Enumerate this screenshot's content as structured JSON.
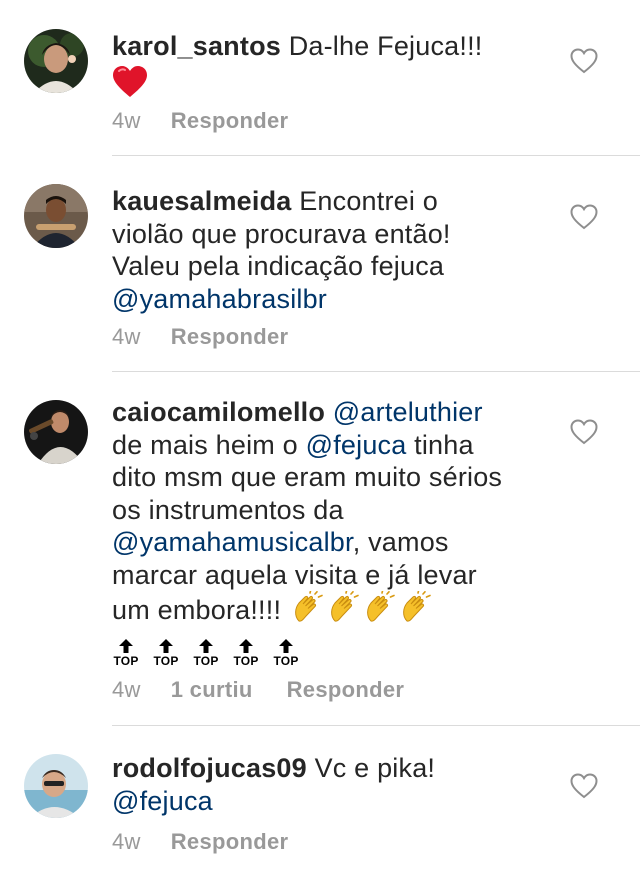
{
  "comments": [
    {
      "username": "karol_santos",
      "text": "Da-lhe Fejuca!!!",
      "emoji": "❤️",
      "time": "4w",
      "reply_label": "Responder"
    },
    {
      "username": "kauesalmeida",
      "text_line1": "Encontrei o",
      "text_line2": "violão que procurava então!",
      "text_line3": "Valeu pela indicação fejuca",
      "mention": "@yamahabrasilbr",
      "time": "4w",
      "reply_label": "Responder"
    },
    {
      "username": "caiocamilomello",
      "mention1": "@arteluthier",
      "text_a": "de mais heim o",
      "mention2": "@fejuca",
      "text_b": "tinha",
      "text_c": "dito msm que eram muito sérios",
      "text_d": "os instrumentos da",
      "mention3": "@yamahamusicalbr",
      "text_e": ", vamos",
      "text_f": "marcar aquela visita e já levar",
      "text_g": "um embora!!!!",
      "top_label": "TOP",
      "time": "4w",
      "likes": "1 curtiu",
      "reply_label": "Responder"
    },
    {
      "username": "rodolfojucas09",
      "text": "Vc e pika!",
      "mention": "@fejuca",
      "time": "4w",
      "reply_label": "Responder"
    }
  ],
  "colors": {
    "text": "#262626",
    "mention": "#003569",
    "meta": "#999999",
    "divider": "#dbdbdb"
  }
}
